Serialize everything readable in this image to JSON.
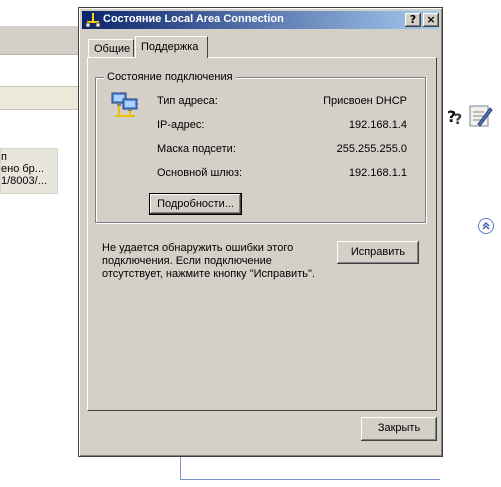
{
  "dialog": {
    "title": "Состояние Local Area Connection",
    "help_button": "?",
    "close_button": "×",
    "tabs": [
      {
        "label": "Общие",
        "active": false
      },
      {
        "label": "Поддержка",
        "active": true
      }
    ],
    "group": {
      "legend": "Состояние подключения",
      "rows": [
        {
          "label": "Тип адреса:",
          "value": "Присвоен DHCP"
        },
        {
          "label": "IP-адрес:",
          "value": "192.168.1.4"
        },
        {
          "label": "Маска подсети:",
          "value": "255.255.255.0"
        },
        {
          "label": "Основной шлюз:",
          "value": "192.168.1.1"
        }
      ],
      "details_button": "Подробности..."
    },
    "info_text": "Не удается обнаружить ошибки этого подключения. Если подключение отсутствует, нажмите кнопку \"Исправить\".",
    "repair_button": "Исправить",
    "close_dialog_button": "Закрыть"
  },
  "background": {
    "left_selected_lines": [
      "п",
      "ено бр...",
      "1/8003/..."
    ]
  },
  "colors": {
    "dialog_face": "#d4d0c8",
    "title_gradient_start": "#0a246a",
    "title_gradient_end": "#a6caf0",
    "panel_accent": "#7b96cf"
  },
  "icons": {
    "title": "network-connection-icon",
    "status": "network-computers-icon",
    "toolbar": [
      "help-icon",
      "edit-icon"
    ],
    "collapse": "chevron-up-icon"
  }
}
